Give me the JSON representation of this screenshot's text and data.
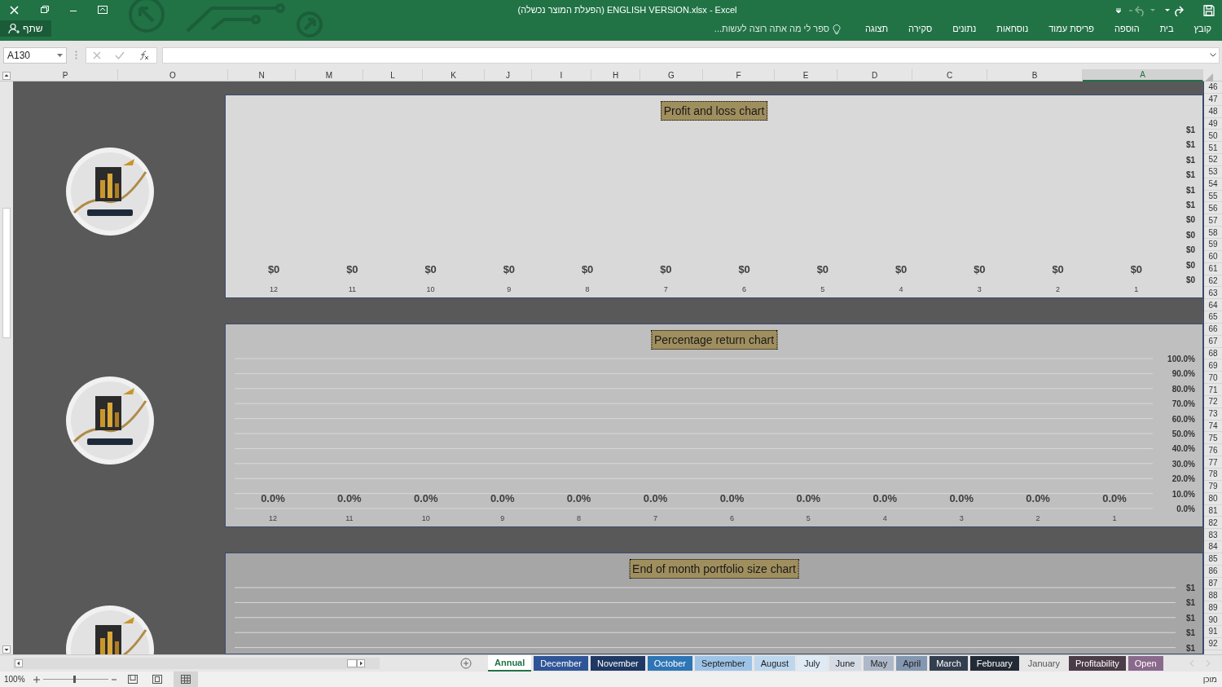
{
  "window": {
    "title": "(הפעלת המוצר נכשלה) ENGLISH VERSION.xlsx - Excel"
  },
  "ribbon": {
    "tabs": [
      {
        "label": "קובץ",
        "selected": false
      },
      {
        "label": "בית",
        "selected": false
      },
      {
        "label": "הוספה",
        "selected": false
      },
      {
        "label": "פריסת עמוד",
        "selected": false
      },
      {
        "label": "נוסחאות",
        "selected": false
      },
      {
        "label": "נתונים",
        "selected": false
      },
      {
        "label": "סקירה",
        "selected": false
      },
      {
        "label": "תצוגה",
        "selected": false
      }
    ],
    "tell_me": "ספר לי מה אתה רוצה לעשות...",
    "share": "שתף"
  },
  "formula_bar": {
    "name_box": "A130"
  },
  "columns": [
    {
      "label": "P",
      "selected": false
    },
    {
      "label": "O",
      "selected": false
    },
    {
      "label": "N",
      "selected": false
    },
    {
      "label": "M",
      "selected": false
    },
    {
      "label": "L",
      "selected": false
    },
    {
      "label": "K",
      "selected": false
    },
    {
      "label": "J",
      "selected": false
    },
    {
      "label": "I",
      "selected": false
    },
    {
      "label": "H",
      "selected": false
    },
    {
      "label": "G",
      "selected": false
    },
    {
      "label": "F",
      "selected": false
    },
    {
      "label": "E",
      "selected": false
    },
    {
      "label": "D",
      "selected": false
    },
    {
      "label": "C",
      "selected": false
    },
    {
      "label": "B",
      "selected": false
    },
    {
      "label": "A",
      "selected": true
    }
  ],
  "rows": [
    "46",
    "47",
    "48",
    "49",
    "50",
    "51",
    "52",
    "53",
    "54",
    "55",
    "56",
    "57",
    "58",
    "59",
    "60",
    "61",
    "62",
    "63",
    "64",
    "65",
    "66",
    "67",
    "68",
    "69",
    "70",
    "71",
    "72",
    "73",
    "74",
    "75",
    "76",
    "77",
    "78",
    "79",
    "80",
    "81",
    "82",
    "83",
    "84",
    "85",
    "86",
    "87",
    "88",
    "89",
    "90",
    "91",
    "92"
  ],
  "charts": [
    {
      "color": "#d9d9d9",
      "chart_data": {
        "type": "bar",
        "grid": false,
        "title": "Profit and loss chart",
        "categories": [
          "12",
          "11",
          "10",
          "9",
          "8",
          "7",
          "6",
          "5",
          "4",
          "3",
          "2",
          "1"
        ],
        "values": [
          0,
          0,
          0,
          0,
          0,
          0,
          0,
          0,
          0,
          0,
          0,
          0
        ],
        "value_labels": [
          "$0",
          "$0",
          "$0",
          "$0",
          "$0",
          "$0",
          "$0",
          "$0",
          "$0",
          "$0",
          "$0",
          "$0"
        ],
        "ylim": [
          0,
          1
        ],
        "yticks": [
          {
            "value": 1,
            "label": "$1"
          },
          {
            "value": 0.9,
            "label": "$1"
          },
          {
            "value": 0.8,
            "label": "$1"
          },
          {
            "value": 0.7,
            "label": "$1"
          },
          {
            "value": 0.6,
            "label": "$1"
          },
          {
            "value": 0.5,
            "label": "$1"
          },
          {
            "value": 0.4,
            "label": "$0"
          },
          {
            "value": 0.3,
            "label": "$0"
          },
          {
            "value": 0.2,
            "label": "$0"
          },
          {
            "value": 0.1,
            "label": "$0"
          },
          {
            "value": 0,
            "label": "$0"
          }
        ]
      }
    },
    {
      "color": "#bfbfbf",
      "chart_data": {
        "type": "bar",
        "grid": true,
        "title": "Percentage return chart",
        "categories": [
          "12",
          "11",
          "10",
          "9",
          "8",
          "7",
          "6",
          "5",
          "4",
          "3",
          "2",
          "1"
        ],
        "values": [
          0,
          0,
          0,
          0,
          0,
          0,
          0,
          0,
          0,
          0,
          0,
          0
        ],
        "value_labels": [
          "0.0%",
          "0.0%",
          "0.0%",
          "0.0%",
          "0.0%",
          "0.0%",
          "0.0%",
          "0.0%",
          "0.0%",
          "0.0%",
          "0.0%",
          "0.0%"
        ],
        "ylim": [
          0,
          1
        ],
        "yticks": [
          {
            "value": 1,
            "label": "100.0%"
          },
          {
            "value": 0.9,
            "label": "90.0%"
          },
          {
            "value": 0.8,
            "label": "80.0%"
          },
          {
            "value": 0.7,
            "label": "70.0%"
          },
          {
            "value": 0.6,
            "label": "60.0%"
          },
          {
            "value": 0.5,
            "label": "50.0%"
          },
          {
            "value": 0.4,
            "label": "40.0%"
          },
          {
            "value": 0.3,
            "label": "30.0%"
          },
          {
            "value": 0.2,
            "label": "20.0%"
          },
          {
            "value": 0.1,
            "label": "10.0%"
          },
          {
            "value": 0,
            "label": "0.0%"
          }
        ]
      }
    },
    {
      "color": "#a6a6a6",
      "grid": true,
      "title": "End of month portfolio size chart",
      "axis_labels": [
        "$1",
        "$1",
        "$1",
        "$1",
        "$1"
      ]
    }
  ],
  "sheet_tabs": [
    {
      "label": "Annual",
      "selected": true
    },
    {
      "label": "December",
      "selected": false,
      "color": "#2f5597"
    },
    {
      "label": "November",
      "selected": false,
      "color": "#1f3864"
    },
    {
      "label": "October",
      "selected": false,
      "color": "#2e75b6"
    },
    {
      "label": "September",
      "selected": false,
      "color": "#9dc3e6"
    },
    {
      "label": "August",
      "selected": false,
      "color": "#bdd7ee"
    },
    {
      "label": "July",
      "selected": false,
      "color": "#deebf7"
    },
    {
      "label": "June",
      "selected": false,
      "color": "#d6dce5"
    },
    {
      "label": "May",
      "selected": false,
      "color": "#adb9ca"
    },
    {
      "label": "April",
      "selected": false,
      "color": "#8497b0"
    },
    {
      "label": "March",
      "selected": false,
      "color": "#333f4f"
    },
    {
      "label": "February",
      "selected": false,
      "color": "#222a35"
    },
    {
      "label": "January",
      "selected": false
    },
    {
      "label": "Profitability",
      "selected": false,
      "color": "#4b3c47"
    },
    {
      "label": "Open",
      "selected": false,
      "color": "#8a6a8c"
    }
  ],
  "status_bar": {
    "zoom": "100%",
    "zoom_slider": {
      "level": 0.47
    },
    "status": "מוכן"
  }
}
